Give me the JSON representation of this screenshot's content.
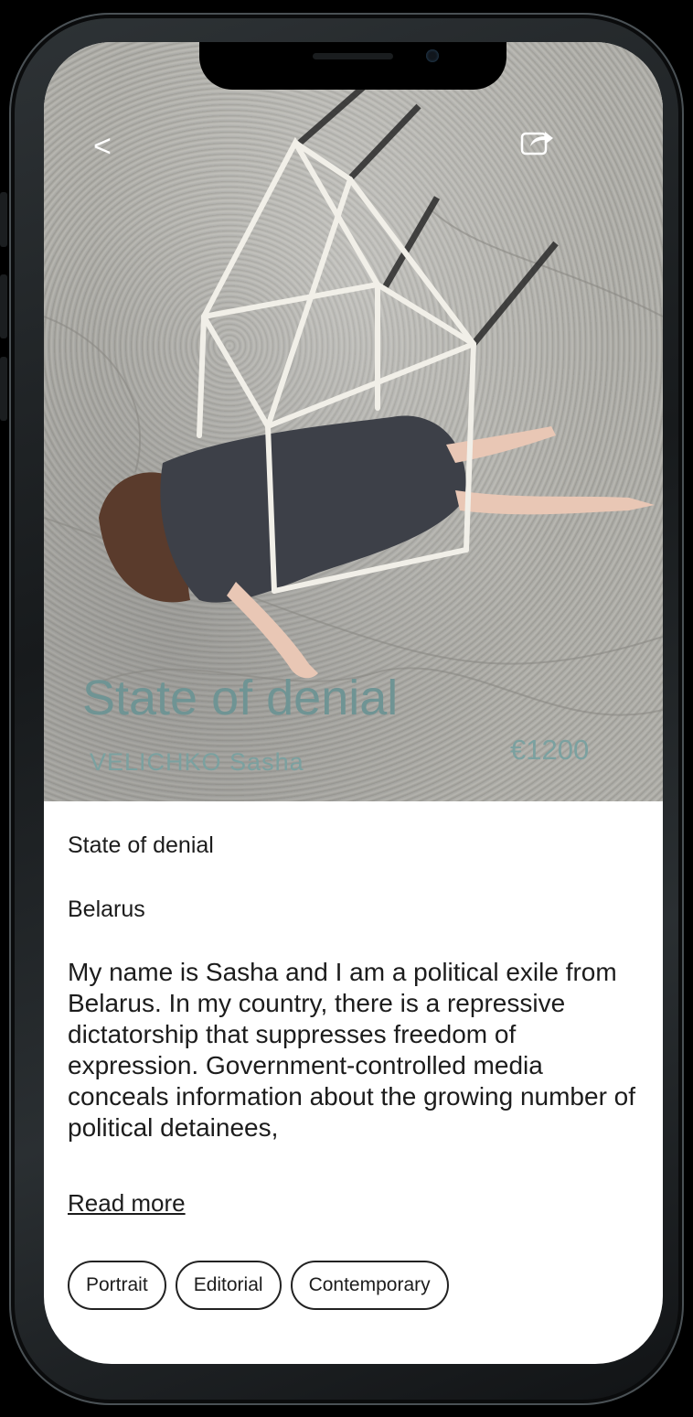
{
  "nav": {
    "back_label": "<",
    "share_icon": "share-icon"
  },
  "artwork": {
    "title": "State of denial",
    "artist": "VELICHKO Sasha",
    "price": "€1200"
  },
  "details": {
    "title": "State of denial",
    "country": "Belarus",
    "description": "My name is Sasha and I am a political exile from Belarus. In my country, there is a repressive dictatorship that suppresses freedom of expression. Government-controlled media conceals information about the growing number of political detainees,",
    "read_more_label": "Read more"
  },
  "tags": [
    "Portrait",
    "Editorial",
    "Contemporary"
  ],
  "colors": {
    "accent": "#6f9494",
    "text": "#1c1c1c",
    "tag_border": "#222222"
  }
}
